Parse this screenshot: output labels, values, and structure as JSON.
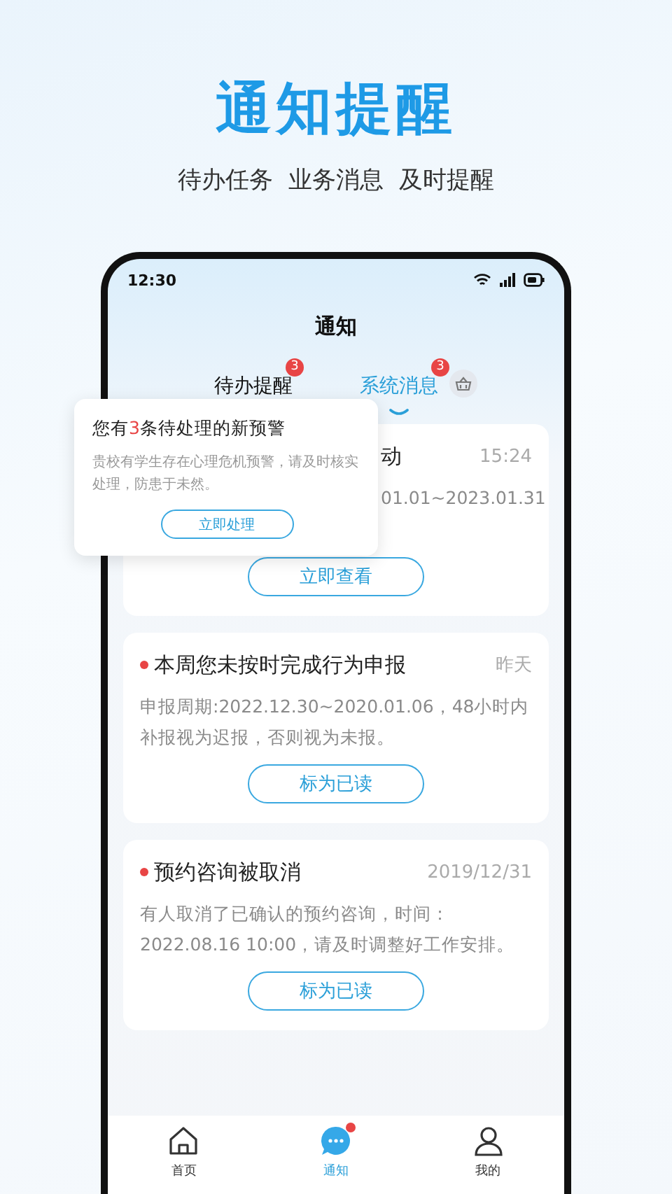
{
  "headline": "通知提醒",
  "subtitle": "待办任务  业务消息  及时提醒",
  "status_bar": {
    "time": "12:30"
  },
  "screen_title": "通知",
  "tabs": [
    {
      "label": "待办提醒",
      "badge": "3",
      "selected": false
    },
    {
      "label": "系统消息",
      "badge": "3",
      "selected": true
    }
  ],
  "popup": {
    "title": "您有**3**条待处理的新预警",
    "body": "贵校有学生存在心理危机预警，请及时核实处理，防患于未然。",
    "button": "立即处理"
  },
  "cards": [
    {
      "title": "动",
      "unread": false,
      "time": "15:24",
      "body": "01.01~2023.01.31",
      "button": "立即查看",
      "covered": true
    },
    {
      "title": "本周您未按时完成行为申报",
      "unread": true,
      "time": "昨天",
      "body": "申报周期:2022.12.30~2020.01.06，48小时内补报视为迟报，否则视为未报。",
      "button": "标为已读",
      "covered": false
    },
    {
      "title": "预约咨询被取消",
      "unread": true,
      "time": "2019/12/31",
      "body": "有人取消了已确认的预约咨询，时间：2022.08.16 10:00，请及时调整好工作安排。",
      "button": "标为已读",
      "covered": false
    }
  ],
  "nav": [
    {
      "kind": "home",
      "label": "首页",
      "selected": false,
      "dot": false
    },
    {
      "kind": "chat",
      "label": "通知",
      "selected": true,
      "dot": true
    },
    {
      "kind": "person",
      "label": "我的",
      "selected": false,
      "dot": false
    }
  ]
}
